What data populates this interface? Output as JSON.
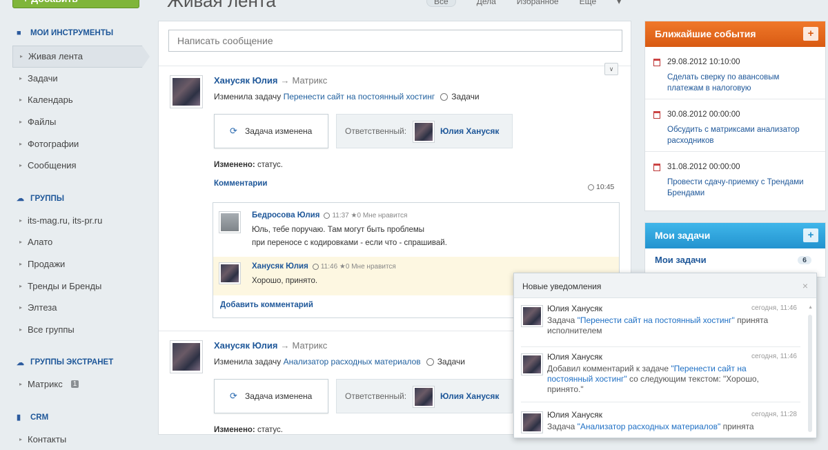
{
  "header": {
    "add_button": "+ Добавить",
    "title": "Живая лента",
    "filters": [
      "Все",
      "Дела",
      "Избранное",
      "Ещё"
    ]
  },
  "sidebar": {
    "sections": [
      {
        "title": "МОИ ИНСТРУМЕНТЫ",
        "icon": "flag-icon",
        "items": [
          "Живая лента",
          "Задачи",
          "Календарь",
          "Файлы",
          "Фотографии",
          "Сообщения"
        ]
      },
      {
        "title": "ГРУППЫ",
        "icon": "group-icon",
        "items": [
          "its-mag.ru, its-pr.ru",
          "Алато",
          "Продажи",
          "Тренды и Бренды",
          "Элтеза",
          "Все группы"
        ]
      },
      {
        "title": "ГРУППЫ ЭКСТРАНЕТ",
        "icon": "cloud-icon",
        "items": [
          "Матрикс"
        ],
        "badge": "1"
      },
      {
        "title": "CRM",
        "icon": "crm-icon",
        "items": [
          "Контакты"
        ]
      }
    ]
  },
  "feed": {
    "message_placeholder": "Написать сообщение",
    "posts": [
      {
        "author": "Ханусяк Юлия",
        "target": "Матрикс",
        "action": "Изменила задачу",
        "task_link": "Перенести сайт на постоянный хостинг",
        "category": "Задачи",
        "status_box": "Задача изменена",
        "responsible_label": "Ответственный:",
        "responsible_name": "Юлия Ханусяк",
        "changed_label": "Изменено:",
        "changed_value": "статус.",
        "comments_label": "Комментарии",
        "time": "10:45",
        "comments": [
          {
            "author": "Бедросова Юлия",
            "time": "11:37",
            "likes": "★0 Мне нравится",
            "line1": "Юль, тебе поручаю. Там могут быть проблемы",
            "line2": "при переносе с кодировками - если что - спрашивай."
          },
          {
            "author": "Ханусяк Юлия",
            "time": "11:46",
            "likes": "★0 Мне нравится",
            "line1": "Хорошо, принято."
          }
        ],
        "add_comment": "Добавить комментарий"
      },
      {
        "author": "Ханусяк Юлия",
        "target": "Матрикс",
        "action": "Изменила задачу",
        "task_link": "Анализатор расходных материалов",
        "category": "Задачи",
        "status_box": "Задача изменена",
        "responsible_label": "Ответственный:",
        "responsible_name": "Юлия Ханусяк",
        "changed_label": "Изменено:",
        "changed_value": "статус."
      }
    ]
  },
  "events": {
    "title": "Ближайшие события",
    "plus": "+",
    "items": [
      {
        "date": "29.08.2012 10:10:00",
        "title": "Сделать сверку по авансовым платежам в налоговую"
      },
      {
        "date": "30.08.2012 00:00:00",
        "title": "Обсудить с матриксами анализатор расходников"
      },
      {
        "date": "31.08.2012 00:00:00",
        "title": "Провести сдачу-приемку с Трендами Брендами"
      }
    ]
  },
  "tasks": {
    "title": "Мои задачи",
    "plus": "+",
    "row_label": "Мои задачи",
    "count": "6"
  },
  "notifications": {
    "title": "Новые уведомления",
    "close": "×",
    "items": [
      {
        "name": "Юлия Ханусяк",
        "time": "сегодня, 11:46",
        "pre": "Задача ",
        "link": "\"Перенести сайт на постоянный хостинг\"",
        "post": " принята исполнителем"
      },
      {
        "name": "Юлия Ханусяк",
        "time": "сегодня, 11:46",
        "pre": "Добавил комментарий к задаче ",
        "link": "\"Перенести сайт на постоянный хостинг\"",
        "post": " со следующим текстом: \"Хорошо, принято.\""
      },
      {
        "name": "Юлия Ханусяк",
        "time": "сегодня, 11:28",
        "pre": "Задача ",
        "link": "\"Анализатор расходных материалов\"",
        "post": " принята"
      }
    ]
  },
  "colors": {
    "events_header": "#e2641a",
    "tasks_header": "#2a9fd8",
    "add_button": "#7fb53a"
  }
}
